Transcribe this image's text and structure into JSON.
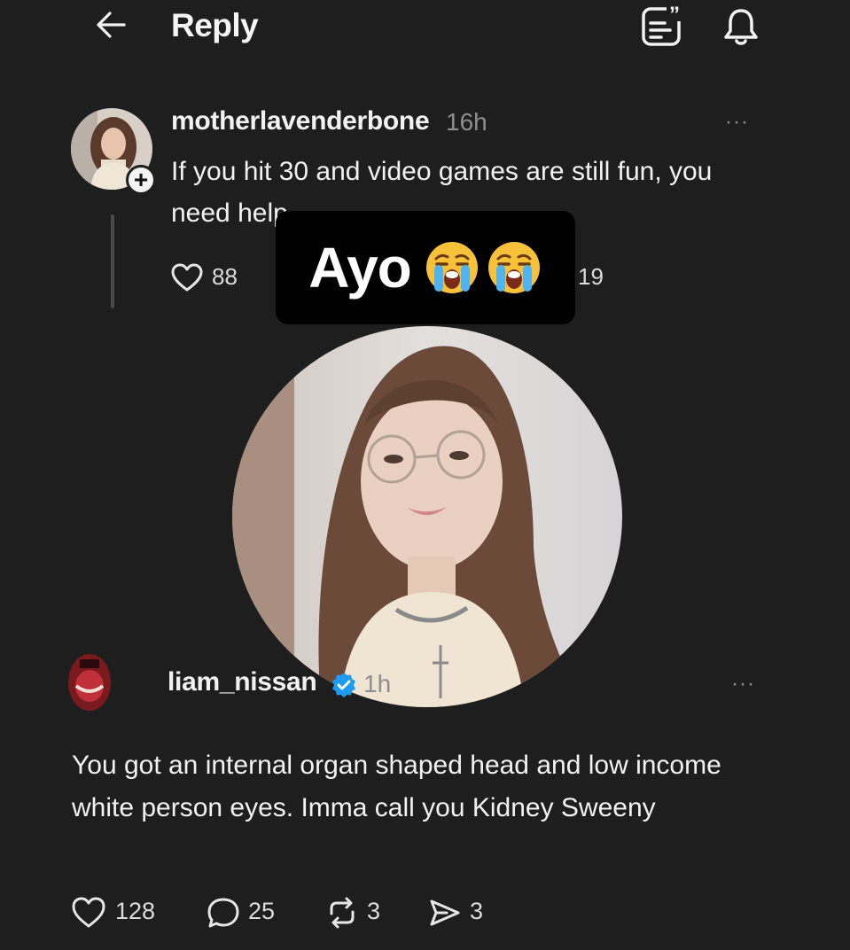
{
  "header": {
    "title": "Reply",
    "back_icon": "arrow-left-icon",
    "feed_icon": "feed-quote-icon",
    "bell_icon": "bell-icon"
  },
  "parent_post": {
    "username": "motherlavenderbone",
    "time": "16h",
    "more": "···",
    "text": "If you hit 30 and video games are still fun, you need help",
    "likes": "88",
    "reposts": "19"
  },
  "overlay": {
    "text": "Ayo",
    "emoji": "loudly-crying-face-emoji"
  },
  "reply_post": {
    "username": "liam_nissan",
    "verified_icon": "verified-badge-icon",
    "time": "1h",
    "more": "···",
    "text": "You got an internal organ shaped head and low income white person eyes. Imma call you Kidney Sweeny",
    "likes": "128",
    "comments": "25",
    "reposts": "3",
    "shares": "3"
  },
  "colors": {
    "background": "#1e1e1e",
    "text": "#f2f2f2",
    "muted": "#8e8e8e",
    "verified": "#1d9bf0",
    "overlay_bg": "#000000"
  }
}
